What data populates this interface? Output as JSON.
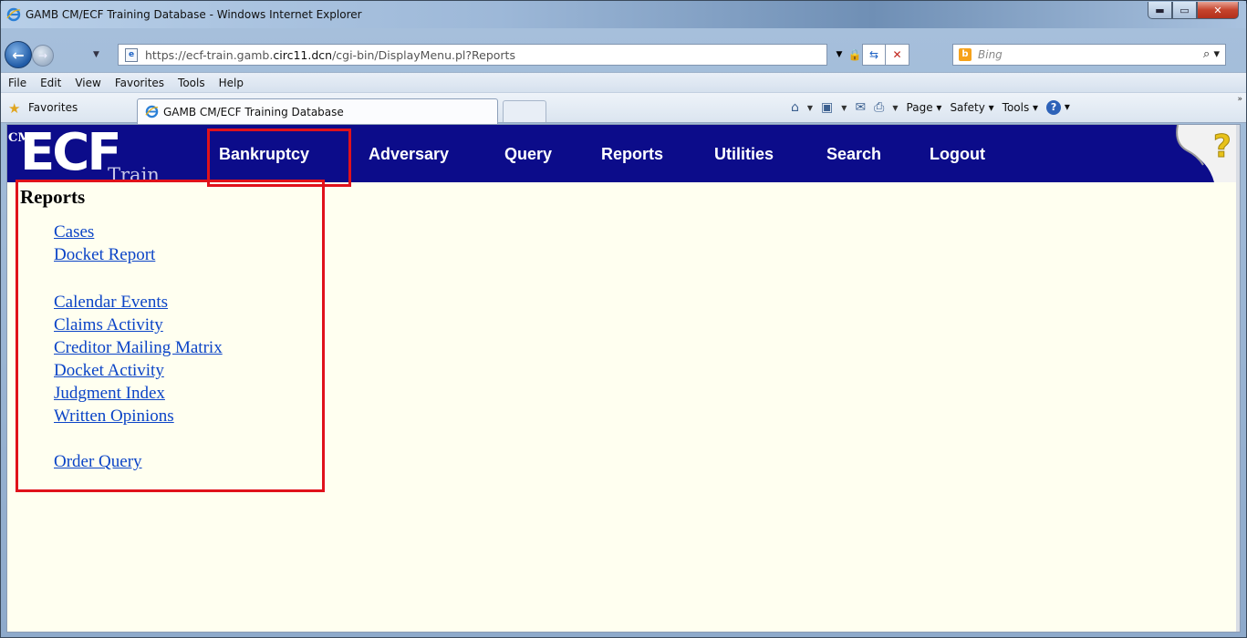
{
  "browser": {
    "window_title": "GAMB CM/ECF Training Database - Windows Internet Explorer",
    "url_prefix": "https://ecf-train.gamb.",
    "url_domain": "circ11.dcn",
    "url_suffix": "/cgi-bin/DisplayMenu.pl?Reports",
    "search_placeholder": "Bing",
    "menu": [
      "File",
      "Edit",
      "View",
      "Favorites",
      "Tools",
      "Help"
    ],
    "favorites_label": "Favorites",
    "tab_title": "GAMB CM/ECF Training Database",
    "commands": {
      "page": "Page",
      "safety": "Safety",
      "tools": "Tools"
    }
  },
  "app": {
    "logo_cm": "CM",
    "logo_main": "ECF",
    "logo_sub": "Train",
    "nav": [
      "Bankruptcy",
      "Adversary",
      "Query",
      "Reports",
      "Utilities",
      "Search",
      "Logout"
    ]
  },
  "content": {
    "heading": "Reports",
    "links_group1": [
      "Cases",
      "Docket Report"
    ],
    "links_group2": [
      "Calendar Events",
      "Claims Activity",
      "Creditor Mailing Matrix",
      "Docket Activity",
      "Judgment Index",
      "Written Opinions"
    ],
    "links_group3": [
      "Order Query"
    ]
  },
  "colors": {
    "header_bg": "#0c0c8a",
    "page_bg": "#fffff0",
    "link": "#0b44c7",
    "annotation": "#e0121b"
  }
}
